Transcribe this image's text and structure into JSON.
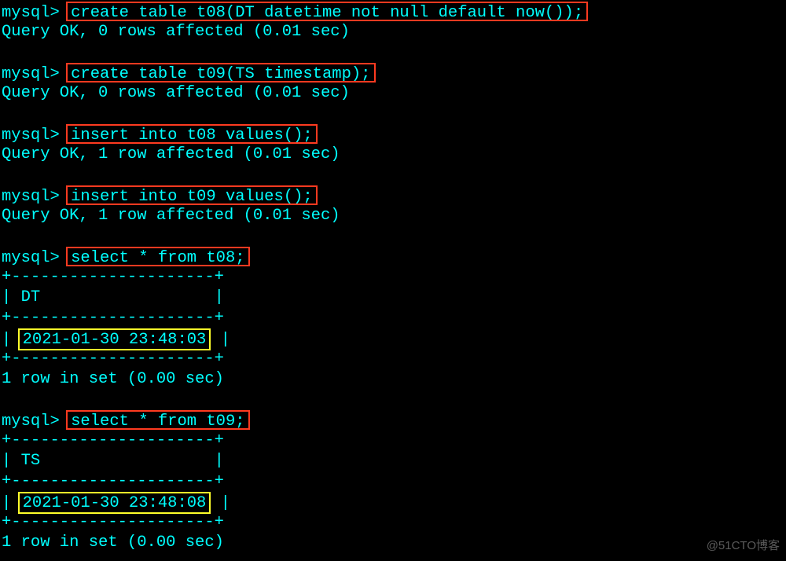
{
  "prompt": "mysql> ",
  "cmds": {
    "c1": "create table t08(DT datetime not null default now());",
    "c2": "create table t09(TS timestamp);",
    "c3": "insert into t08 values();",
    "c4": "insert into t09 values();",
    "c5": "select * from t08;",
    "c6": "select * from t09;"
  },
  "results": {
    "r0": "Query OK, 0 rows affected (0.01 sec)",
    "r1": "Query OK, 1 row affected (0.01 sec)",
    "rowset": "1 row in set (0.00 sec)"
  },
  "tables": {
    "t08": {
      "border": "+---------------------+",
      "header": "| DT                  |",
      "row": "| 2021-01-30 23:48:03 |",
      "value": "2021-01-30 23:48:03"
    },
    "t09": {
      "border": "+---------------------+",
      "header": "| TS                  |",
      "row": "| 2021-01-30 23:48:08 |",
      "value": "2021-01-30 23:48:08"
    }
  },
  "watermark": "@51CTO博客"
}
